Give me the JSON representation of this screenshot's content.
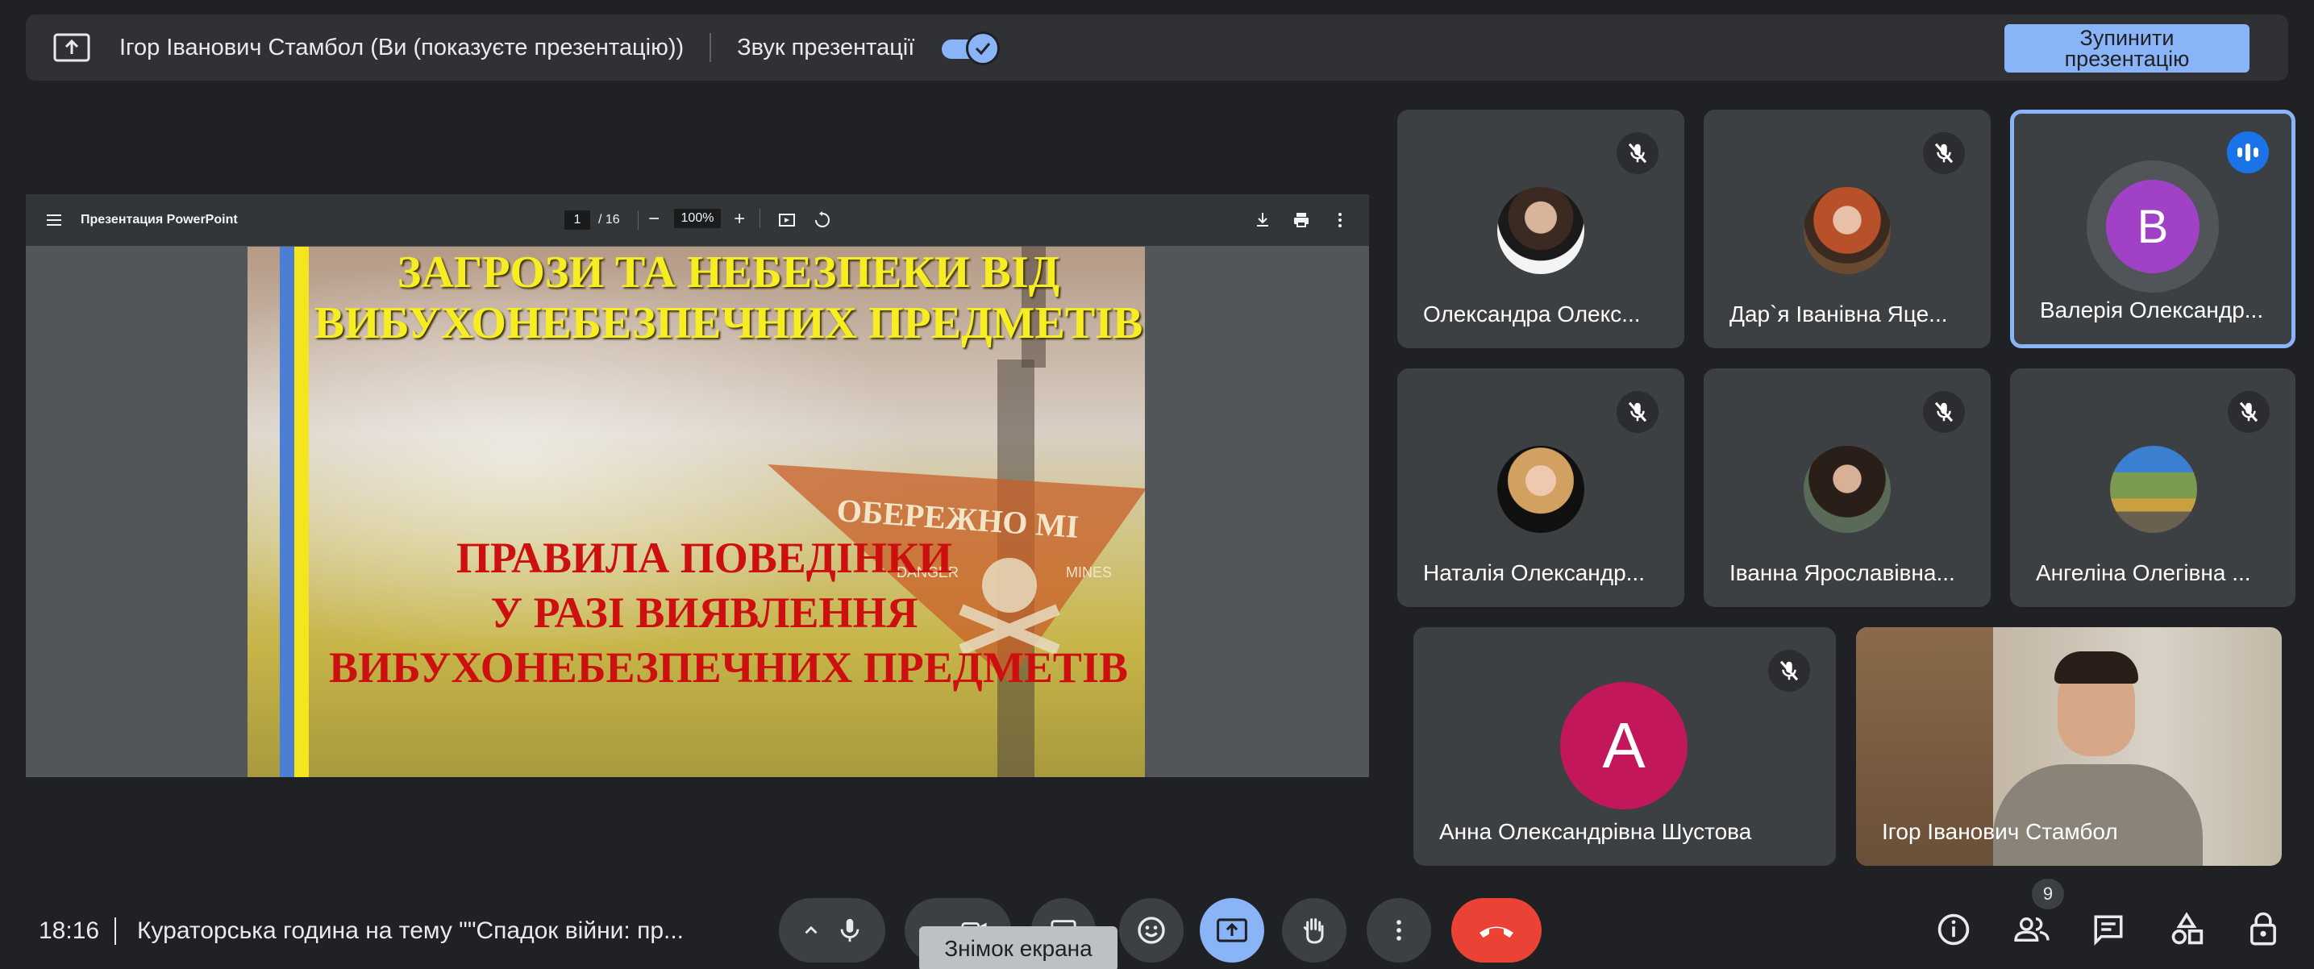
{
  "banner": {
    "presenter_text": "Ігор Іванович Стамбол (Ви (показуєте презентацію))",
    "sound_label": "Звук презентації",
    "sound_on": true,
    "stop_line1": "Зупинити",
    "stop_line2": "презентацію"
  },
  "viewer": {
    "doc_title": "Презентация PowerPoint",
    "page_current": "1",
    "page_total": "/ 16",
    "zoom": "100%"
  },
  "slide": {
    "line1": "ЗАГРОЗИ ТА НЕБЕЗПЕКИ ВІД",
    "line2": "ВИБУХОНЕБЕЗПЕЧНИХ ПРЕДМЕТІВ",
    "line3": "ПРАВИЛА ПОВЕДІНКИ",
    "line4": "У РАЗІ ВИЯВЛЕННЯ",
    "line5": "ВИБУХОНЕБЕЗПЕЧНИХ ПРЕДМЕТІВ",
    "sign_text": "ОБЕРЕЖНО МІ",
    "sign_small_left": "DANGER",
    "sign_small_right": "MINES"
  },
  "participants": [
    {
      "name": "Олександра Олекс...",
      "muted": true
    },
    {
      "name": "Дар`я Іванівна Яце...",
      "muted": true
    },
    {
      "name": "Валерія Олександр...",
      "muted": false,
      "speaking": true,
      "initial": "В",
      "avatar_color": "#a142c6"
    },
    {
      "name": "Наталія Олександр...",
      "muted": true
    },
    {
      "name": "Іванна Ярославівна...",
      "muted": true
    },
    {
      "name": "Ангеліна Олегівна ...",
      "muted": true
    },
    {
      "name": "Анна Олександрівна Шустова",
      "muted": true,
      "initial": "А",
      "avatar_color": "#c2185b"
    },
    {
      "name": "Ігор Іванович Стамбол",
      "muted": false
    }
  ],
  "bottom": {
    "clock": "18:16",
    "meeting_title": "Кураторська година на тему \"\"Спадок війни: пр...",
    "tooltip": "Знімок екрана",
    "people_count": "9"
  },
  "colors": {
    "background": "#202124",
    "accent": "#8ab4f8",
    "end_call": "#ea4335",
    "tile": "#3c4043"
  }
}
